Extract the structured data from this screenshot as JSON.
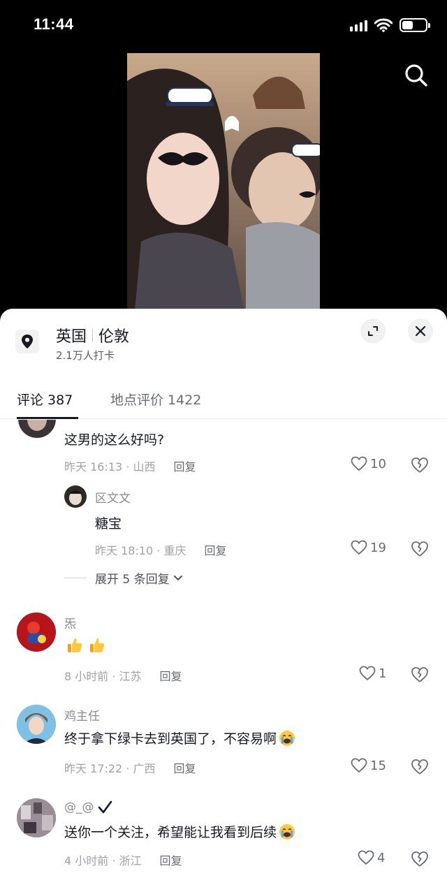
{
  "status_bar": {
    "time": "11:44"
  },
  "location": {
    "country": "英国",
    "city": "伦敦",
    "checkins": "2.1万人打卡"
  },
  "tabs": [
    {
      "label": "评论 387"
    },
    {
      "label": "地点评价 1422"
    }
  ],
  "comments": [
    {
      "text": "这男的这么好吗?",
      "time": "昨天 16:13 · 山西",
      "reply_label": "回复",
      "likes": "10",
      "replies": [
        {
          "username": "区文文",
          "text": "糖宝",
          "time": "昨天 18:10 · 重庆",
          "reply_label": "回复",
          "likes": "19"
        }
      ],
      "expand_label": "展开 5 条回复"
    },
    {
      "username": "炁",
      "text": "",
      "time": "8 小时前 · 江苏",
      "reply_label": "回复",
      "likes": "1"
    },
    {
      "username": "鸡主任",
      "text": "终于拿下绿卡去到英国了，不容易啊",
      "time": "昨天 17:22 · 广西",
      "reply_label": "回复",
      "likes": "15"
    },
    {
      "username": "@_@",
      "text": "送你一个关注，希望能让我看到后续",
      "time": "4 小时前 · 浙江",
      "reply_label": "回复",
      "likes": "4"
    }
  ],
  "icons": {
    "search": "search-icon",
    "location": "location-pin-icon",
    "expand": "expand-icon",
    "close": "close-icon",
    "like": "heart-icon",
    "dislike": "broken-heart-icon",
    "chevron": "chevron-down-icon"
  },
  "colors": {
    "background": "#000000",
    "sheet": "#ffffff",
    "text": "#161823",
    "muted": "#a1a2a7"
  }
}
